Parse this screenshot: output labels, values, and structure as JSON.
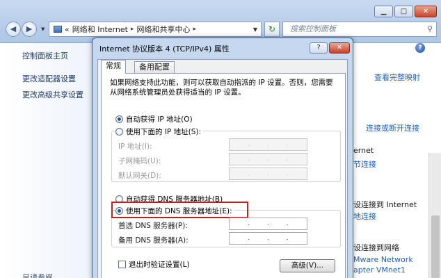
{
  "explorer": {
    "window_controls": {
      "minimize": "▁",
      "maximize": "□",
      "close": "✕"
    },
    "address": {
      "root_icon": "network-folder-icon",
      "chevrons": "«",
      "crumbs": [
        "网络和 Internet",
        "网络和共享中心"
      ],
      "separator": "▸"
    },
    "search_placeholder": "搜索控制面板",
    "left_pane": [
      "控制面板主页",
      "更改适配器设置",
      "更改高级共享设置",
      "另请参阅"
    ],
    "right_pane": {
      "see_map": "查看完整映射",
      "connect_disconnect": "连接或断开连接",
      "internet_fragment": "ernet",
      "connections_fragment": "节连接",
      "connect_internet": "设连接到 Internet",
      "connections_fragment2": "地连接",
      "connect_network": "设连接到网络",
      "vmware_1": "Mware Network",
      "vmware_2": "apter VMnet1"
    }
  },
  "dialog": {
    "title": "Internet 协议版本 4 (TCP/IPv4) 属性",
    "help_label": "?",
    "close_label": "✕",
    "tabs": [
      "常规",
      "备用配置"
    ],
    "intro": "如果网络支持此功能，则可以获取自动指派的 IP 设置。否则，您需要从网络系统管理员处获得适当的 IP 设置。",
    "ip_auto": "自动获得 IP 地址(O)",
    "ip_manual": "使用下面的 IP 地址(S):",
    "ip_address_label": "IP 地址(I):",
    "subnet_label": "子网掩码(U):",
    "gateway_label": "默认网关(D):",
    "dns_auto": "自动获得 DNS 服务器地址(B)",
    "dns_manual": "使用下面的 DNS 服务器地址(E):",
    "preferred_dns_label": "首选 DNS 服务器(P):",
    "alternate_dns_label": "备用 DNS 服务器(A):",
    "ip_dot": ".",
    "validate_on_exit": "退出时验证设置(L)",
    "advanced_button": "高级(V)..."
  }
}
